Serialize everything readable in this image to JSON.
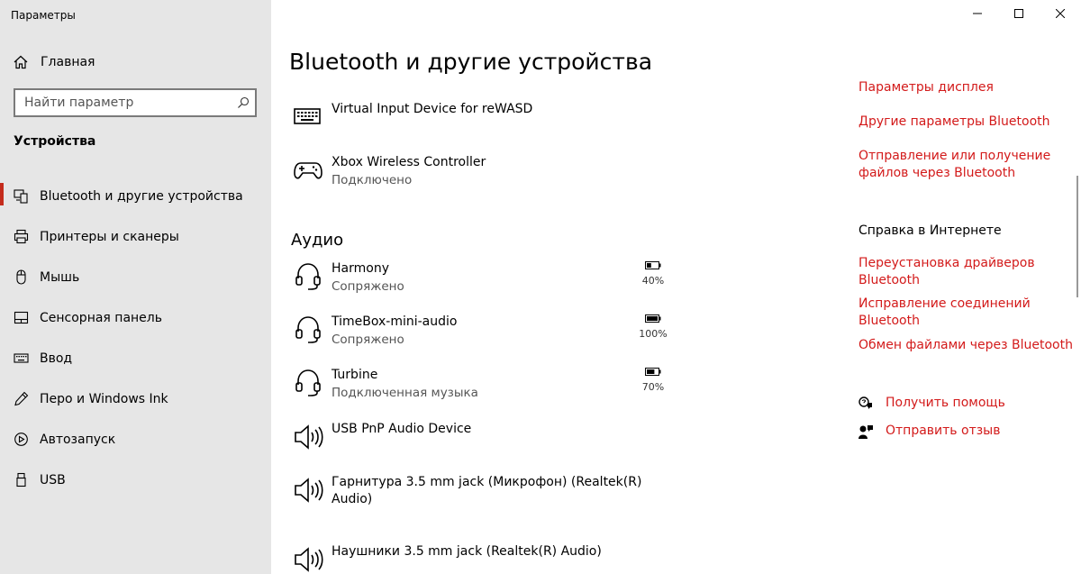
{
  "window": {
    "app_title": "Параметры"
  },
  "sidebar": {
    "home_label": "Главная",
    "search_placeholder": "Найти параметр",
    "section_title": "Устройства",
    "items": [
      {
        "label": "Bluetooth и другие устройства",
        "icon": "bluetooth-devices-icon",
        "active": true
      },
      {
        "label": "Принтеры и сканеры",
        "icon": "printer-icon"
      },
      {
        "label": "Мышь",
        "icon": "mouse-icon"
      },
      {
        "label": "Сенсорная панель",
        "icon": "touchpad-icon"
      },
      {
        "label": "Ввод",
        "icon": "keyboard-icon"
      },
      {
        "label": "Перо и Windows Ink",
        "icon": "pen-icon"
      },
      {
        "label": "Автозапуск",
        "icon": "autoplay-icon"
      },
      {
        "label": "USB",
        "icon": "usb-icon"
      }
    ]
  },
  "main": {
    "title": "Bluetooth и другие устройства",
    "devices": [
      {
        "name": "Virtual Input Device for reWASD",
        "status": "",
        "icon": "keyboard-icon"
      },
      {
        "name": "Xbox Wireless Controller",
        "status": "Подключено",
        "icon": "gamepad-icon"
      }
    ],
    "audio_heading": "Аудио",
    "audio_devices": [
      {
        "name": "Harmony",
        "status": "Сопряжено",
        "icon": "headset-icon",
        "battery": "40%",
        "battery_level": 0.4
      },
      {
        "name": "TimeBox-mini-audio",
        "status": "Сопряжено",
        "icon": "headset-icon",
        "battery": "100%",
        "battery_level": 1.0
      },
      {
        "name": "Turbine",
        "status": "Подключенная музыка",
        "icon": "headset-icon",
        "battery": "70%",
        "battery_level": 0.7
      },
      {
        "name": "USB PnP Audio Device",
        "status": "",
        "icon": "speaker-icon"
      },
      {
        "name": "Гарнитура 3.5 mm jack (Микрофон) (Realtek(R)",
        "name_line2": "Audio)",
        "status": "",
        "icon": "speaker-icon"
      },
      {
        "name": "Наушники 3.5 mm jack (Realtek(R) Audio)",
        "status": "",
        "icon": "speaker-icon"
      }
    ]
  },
  "related": {
    "links": [
      {
        "label": "Параметры дисплея"
      },
      {
        "label": "Другие параметры Bluetooth"
      },
      {
        "label": "Отправление или получение",
        "label2": "файлов через Bluetooth"
      }
    ],
    "help_heading": "Справка в Интернете",
    "help_links": [
      {
        "label": "Переустановка драйверов",
        "label2": "Bluetooth"
      },
      {
        "label": "Исправление соединений",
        "label2": "Bluetooth"
      },
      {
        "label": "Обмен файлами через Bluetooth"
      }
    ],
    "get_help": "Получить помощь",
    "feedback": "Отправить отзыв"
  },
  "colors": {
    "accent": "#d31a1a",
    "sidebar_bg": "#e6e6e6"
  }
}
